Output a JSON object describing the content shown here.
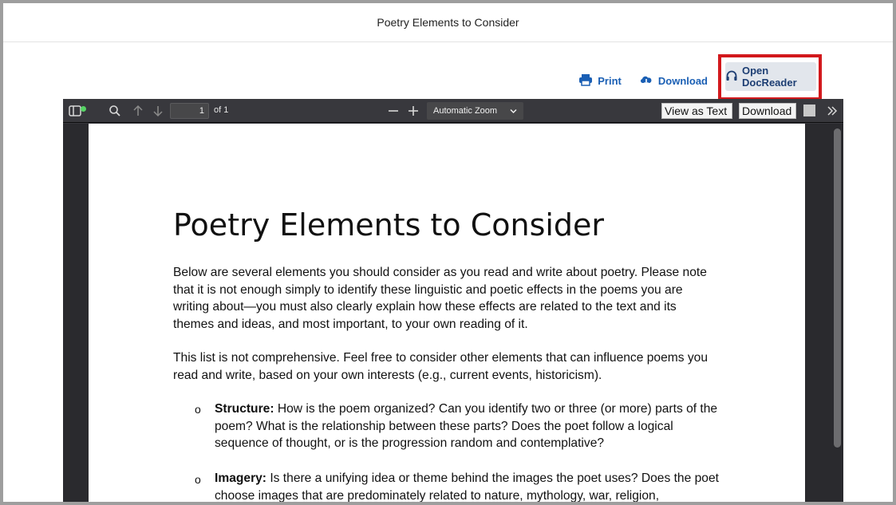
{
  "window": {
    "title": "Poetry Elements to Consider"
  },
  "actions": {
    "print_label": "Print",
    "download_label": "Download",
    "docreader_label": "Open DocReader"
  },
  "viewer": {
    "page_number": "1",
    "page_count": "of 1",
    "zoom": "Automatic Zoom",
    "view_as_text": "View as Text",
    "download": "Download"
  },
  "document": {
    "title": "Poetry Elements to Consider",
    "paragraph1": "Below are several elements you should consider as you read and write about poetry. Please note that it is not enough simply to identify these linguistic and poetic effects in the poems you are writing about—you must also clearly explain how these effects are related to the text and its themes and ideas, and most important, to your own reading of it.",
    "paragraph2": "This list is not comprehensive. Feel free to consider other elements that can influence poems you read and write, based on your own interests (e.g., current events, historicism).",
    "bullet_marker": "o",
    "items": [
      {
        "term": "Structure:",
        "text": " How is the poem organized? Can you identify two or three (or more) parts of the poem? What is the relationship between these parts? Does the poet follow a logical sequence of thought, or is the progression random and contemplative?"
      },
      {
        "term": "Imagery:",
        "text": " Is there a unifying idea or theme behind the images the poet uses? Does the poet choose images that are predominately related to nature, mythology, war, religion,"
      }
    ]
  },
  "colors": {
    "accent": "#1a5fb4",
    "highlight_border": "#d2181c",
    "toolbar_bg": "#38383d"
  }
}
